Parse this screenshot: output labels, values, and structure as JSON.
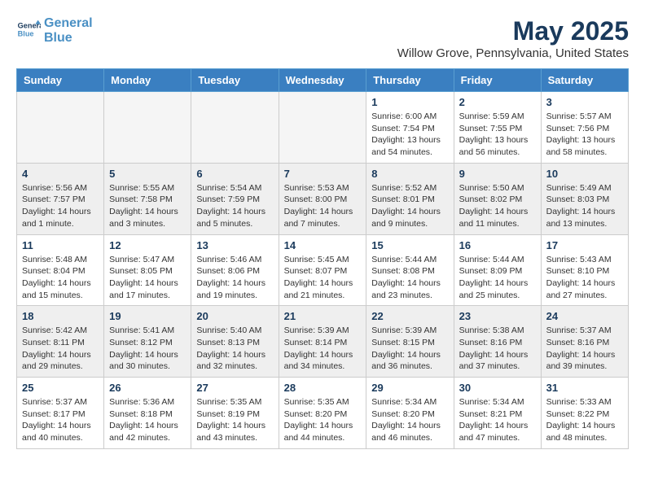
{
  "header": {
    "logo_line1": "General",
    "logo_line2": "Blue",
    "month": "May 2025",
    "location": "Willow Grove, Pennsylvania, United States"
  },
  "weekdays": [
    "Sunday",
    "Monday",
    "Tuesday",
    "Wednesday",
    "Thursday",
    "Friday",
    "Saturday"
  ],
  "weeks": [
    [
      {
        "day": "",
        "info": ""
      },
      {
        "day": "",
        "info": ""
      },
      {
        "day": "",
        "info": ""
      },
      {
        "day": "",
        "info": ""
      },
      {
        "day": "1",
        "info": "Sunrise: 6:00 AM\nSunset: 7:54 PM\nDaylight: 13 hours\nand 54 minutes."
      },
      {
        "day": "2",
        "info": "Sunrise: 5:59 AM\nSunset: 7:55 PM\nDaylight: 13 hours\nand 56 minutes."
      },
      {
        "day": "3",
        "info": "Sunrise: 5:57 AM\nSunset: 7:56 PM\nDaylight: 13 hours\nand 58 minutes."
      }
    ],
    [
      {
        "day": "4",
        "info": "Sunrise: 5:56 AM\nSunset: 7:57 PM\nDaylight: 14 hours\nand 1 minute."
      },
      {
        "day": "5",
        "info": "Sunrise: 5:55 AM\nSunset: 7:58 PM\nDaylight: 14 hours\nand 3 minutes."
      },
      {
        "day": "6",
        "info": "Sunrise: 5:54 AM\nSunset: 7:59 PM\nDaylight: 14 hours\nand 5 minutes."
      },
      {
        "day": "7",
        "info": "Sunrise: 5:53 AM\nSunset: 8:00 PM\nDaylight: 14 hours\nand 7 minutes."
      },
      {
        "day": "8",
        "info": "Sunrise: 5:52 AM\nSunset: 8:01 PM\nDaylight: 14 hours\nand 9 minutes."
      },
      {
        "day": "9",
        "info": "Sunrise: 5:50 AM\nSunset: 8:02 PM\nDaylight: 14 hours\nand 11 minutes."
      },
      {
        "day": "10",
        "info": "Sunrise: 5:49 AM\nSunset: 8:03 PM\nDaylight: 14 hours\nand 13 minutes."
      }
    ],
    [
      {
        "day": "11",
        "info": "Sunrise: 5:48 AM\nSunset: 8:04 PM\nDaylight: 14 hours\nand 15 minutes."
      },
      {
        "day": "12",
        "info": "Sunrise: 5:47 AM\nSunset: 8:05 PM\nDaylight: 14 hours\nand 17 minutes."
      },
      {
        "day": "13",
        "info": "Sunrise: 5:46 AM\nSunset: 8:06 PM\nDaylight: 14 hours\nand 19 minutes."
      },
      {
        "day": "14",
        "info": "Sunrise: 5:45 AM\nSunset: 8:07 PM\nDaylight: 14 hours\nand 21 minutes."
      },
      {
        "day": "15",
        "info": "Sunrise: 5:44 AM\nSunset: 8:08 PM\nDaylight: 14 hours\nand 23 minutes."
      },
      {
        "day": "16",
        "info": "Sunrise: 5:44 AM\nSunset: 8:09 PM\nDaylight: 14 hours\nand 25 minutes."
      },
      {
        "day": "17",
        "info": "Sunrise: 5:43 AM\nSunset: 8:10 PM\nDaylight: 14 hours\nand 27 minutes."
      }
    ],
    [
      {
        "day": "18",
        "info": "Sunrise: 5:42 AM\nSunset: 8:11 PM\nDaylight: 14 hours\nand 29 minutes."
      },
      {
        "day": "19",
        "info": "Sunrise: 5:41 AM\nSunset: 8:12 PM\nDaylight: 14 hours\nand 30 minutes."
      },
      {
        "day": "20",
        "info": "Sunrise: 5:40 AM\nSunset: 8:13 PM\nDaylight: 14 hours\nand 32 minutes."
      },
      {
        "day": "21",
        "info": "Sunrise: 5:39 AM\nSunset: 8:14 PM\nDaylight: 14 hours\nand 34 minutes."
      },
      {
        "day": "22",
        "info": "Sunrise: 5:39 AM\nSunset: 8:15 PM\nDaylight: 14 hours\nand 36 minutes."
      },
      {
        "day": "23",
        "info": "Sunrise: 5:38 AM\nSunset: 8:16 PM\nDaylight: 14 hours\nand 37 minutes."
      },
      {
        "day": "24",
        "info": "Sunrise: 5:37 AM\nSunset: 8:16 PM\nDaylight: 14 hours\nand 39 minutes."
      }
    ],
    [
      {
        "day": "25",
        "info": "Sunrise: 5:37 AM\nSunset: 8:17 PM\nDaylight: 14 hours\nand 40 minutes."
      },
      {
        "day": "26",
        "info": "Sunrise: 5:36 AM\nSunset: 8:18 PM\nDaylight: 14 hours\nand 42 minutes."
      },
      {
        "day": "27",
        "info": "Sunrise: 5:35 AM\nSunset: 8:19 PM\nDaylight: 14 hours\nand 43 minutes."
      },
      {
        "day": "28",
        "info": "Sunrise: 5:35 AM\nSunset: 8:20 PM\nDaylight: 14 hours\nand 44 minutes."
      },
      {
        "day": "29",
        "info": "Sunrise: 5:34 AM\nSunset: 8:20 PM\nDaylight: 14 hours\nand 46 minutes."
      },
      {
        "day": "30",
        "info": "Sunrise: 5:34 AM\nSunset: 8:21 PM\nDaylight: 14 hours\nand 47 minutes."
      },
      {
        "day": "31",
        "info": "Sunrise: 5:33 AM\nSunset: 8:22 PM\nDaylight: 14 hours\nand 48 minutes."
      }
    ]
  ]
}
